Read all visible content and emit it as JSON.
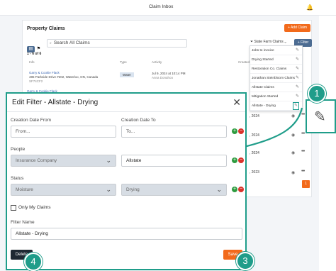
{
  "app": {
    "window_title": "Claim Inbox",
    "panel_title": "Property Claims",
    "add_claim": "+ Add Claim",
    "search_placeholder": "Search All Claims",
    "company_filter": "State Farm Claims",
    "filter_button": "+ Filter",
    "count": "1 - 6 of 6",
    "columns": {
      "info": "Info",
      "type": "Type",
      "activity": "Activity",
      "created": "Created"
    },
    "row1": {
      "name": "Garry & Cookie Flack",
      "address": "485 Parkside Drive #202, Waterloo, ON, Canada",
      "sub": "SF74CF2",
      "type": "Water",
      "activity": "Jul 9, 2024 at 10:14 PM",
      "activity_by": "Anna Donahoo"
    },
    "row2": {
      "name": "Garry & Cookie Flack",
      "address": "485 Parkside Drive #202, Waterloo, ON, Canada"
    },
    "right_dates": [
      ", 2024",
      ", 2024",
      ", 2024",
      ", 2023"
    ],
    "page": "1"
  },
  "dropdown": {
    "items": [
      "Jobs to invoice",
      "Drying Started",
      "Restoration Co. Claims",
      "Jonathan Steinbloom Claims",
      "Allstate Claims",
      "Mitigation Started",
      "Allstate - Drying"
    ]
  },
  "callouts": [
    "1",
    "2",
    "3",
    "4"
  ],
  "modal": {
    "title": "Edit Filter - Allstate - Drying",
    "creation_from_label": "Creation Date From",
    "creation_from_placeholder": "From...",
    "creation_to_label": "Creation Date To",
    "creation_to_placeholder": "To...",
    "people_label": "People",
    "people_field": "Insurance Company",
    "people_value": "Allstate",
    "status_label": "Status",
    "status_field": "Moisture",
    "status_value": "Drying",
    "only_my_claims": "Only My Claims",
    "filter_name_label": "Filter Name",
    "filter_name_value": "Allstate - Drying",
    "delete": "Delete",
    "save": "Save"
  },
  "colors": {
    "accent": "#f26a1b",
    "primary": "#4c6c92",
    "callout": "#1f9d8a",
    "plus": "#2e9b3f",
    "minus": "#d9332b"
  }
}
